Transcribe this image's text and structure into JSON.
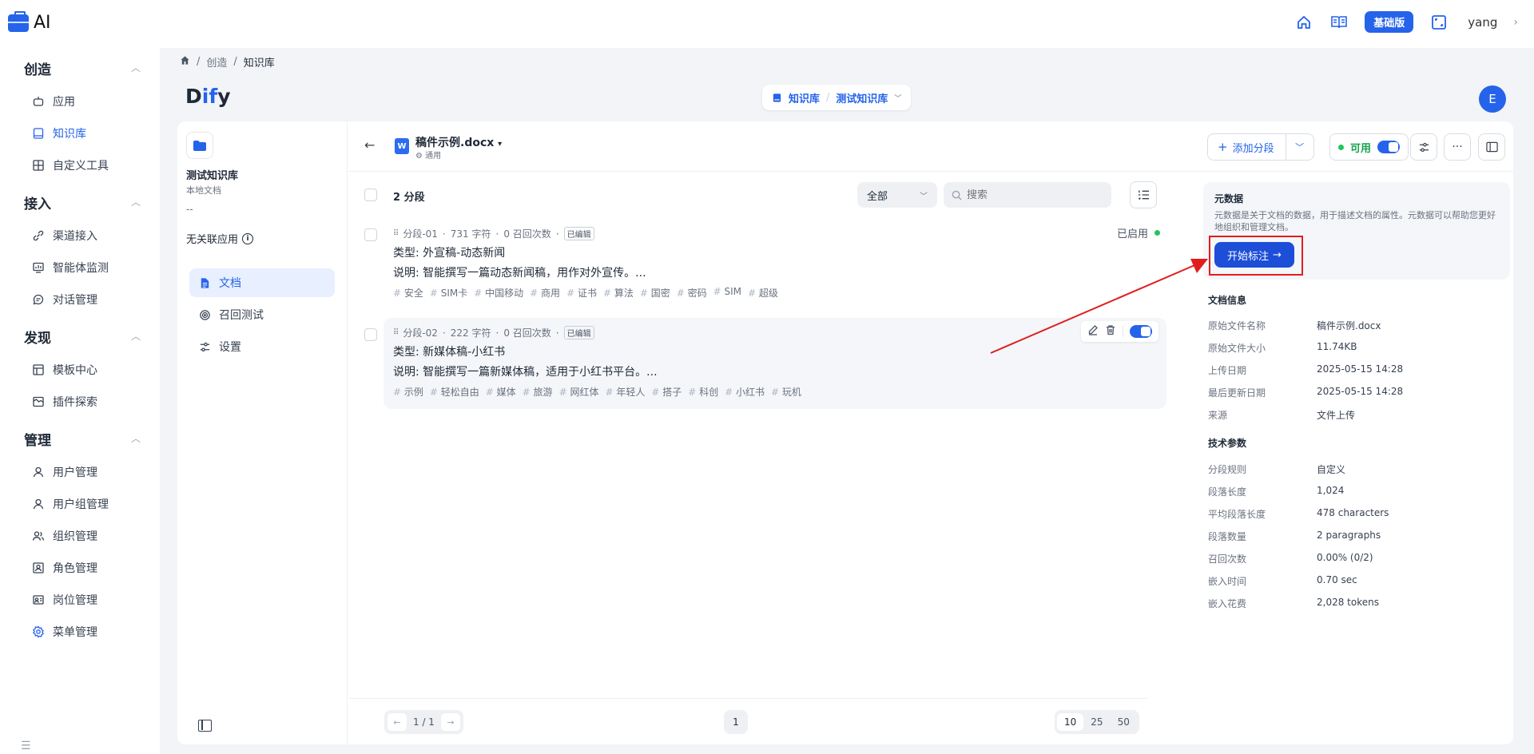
{
  "app": {
    "title": "AI"
  },
  "topbar": {
    "plan": "基础版",
    "username": "yang"
  },
  "sidebar": {
    "sections": [
      {
        "title": "创造",
        "items": [
          {
            "label": "应用",
            "icon": "robot-icon"
          },
          {
            "label": "知识库",
            "icon": "book-icon",
            "active": true
          },
          {
            "label": "自定义工具",
            "icon": "tool-icon"
          }
        ]
      },
      {
        "title": "接入",
        "items": [
          {
            "label": "渠道接入",
            "icon": "link-icon"
          },
          {
            "label": "智能体监测",
            "icon": "monitor-icon"
          },
          {
            "label": "对话管理",
            "icon": "chat-icon"
          }
        ]
      },
      {
        "title": "发现",
        "items": [
          {
            "label": "模板中心",
            "icon": "template-icon"
          },
          {
            "label": "插件探索",
            "icon": "plugin-icon"
          }
        ]
      },
      {
        "title": "管理",
        "items": [
          {
            "label": "用户管理",
            "icon": "user-icon"
          },
          {
            "label": "用户组管理",
            "icon": "user-group-icon"
          },
          {
            "label": "组织管理",
            "icon": "org-icon"
          },
          {
            "label": "角色管理",
            "icon": "role-icon"
          },
          {
            "label": "岗位管理",
            "icon": "post-icon"
          },
          {
            "label": "菜单管理",
            "icon": "menu-icon"
          }
        ]
      }
    ]
  },
  "breadcrumb": {
    "items": [
      "创造",
      "知识库"
    ]
  },
  "dify": {
    "brand_d": "D",
    "brand_i": "if",
    "brand_y": "y",
    "switch_root": "知识库",
    "switch_current": "测试知识库",
    "avatar": "E"
  },
  "kb": {
    "name": "测试知识库",
    "type": "本地文档",
    "dash": "--",
    "apps": "无关联应用",
    "nav": [
      {
        "label": "文档"
      },
      {
        "label": "召回测试"
      },
      {
        "label": "设置"
      }
    ]
  },
  "doc": {
    "title": "稿件示例.docx",
    "mode": "通用",
    "add_segment": "添加分段",
    "available": "可用",
    "segment_count": "2 分段",
    "filter": "全部",
    "search_placeholder": "搜索"
  },
  "segments": [
    {
      "id": "分段-01",
      "chars": "731 字符",
      "recalls": "0 召回次数",
      "edited": "已编辑",
      "line1": "类型: 外宣稿-动态新闻",
      "line2": "说明: 智能撰写一篇动态新闻稿，用作对外宣传。...",
      "tags": [
        "安全",
        "SIM卡",
        "中国移动",
        "商用",
        "证书",
        "算法",
        "国密",
        "密码",
        "SIM",
        "超级"
      ],
      "status": "已启用"
    },
    {
      "id": "分段-02",
      "chars": "222 字符",
      "recalls": "0 召回次数",
      "edited": "已编辑",
      "line1": "类型: 新媒体稿-小红书",
      "line2": "说明: 智能撰写一篇新媒体稿，适用于小红书平台。...",
      "tags": [
        "示例",
        "轻松自由",
        "媒体",
        "旅游",
        "网红体",
        "年轻人",
        "搭子",
        "科创",
        "小红书",
        "玩机"
      ]
    }
  ],
  "pagination": {
    "pager": "1 / 1",
    "current_page": "1",
    "sizes": [
      "10",
      "25",
      "50"
    ],
    "selected_size": "10"
  },
  "metadata": {
    "title": "元数据",
    "desc": "元数据是关于文档的数据，用于描述文档的属性。元数据可以帮助您更好地组织和管理文档。",
    "button": "开始标注"
  },
  "doc_info": {
    "title": "文档信息",
    "rows": [
      {
        "k": "原始文件名称",
        "v": "稿件示例.docx"
      },
      {
        "k": "原始文件大小",
        "v": "11.74KB"
      },
      {
        "k": "上传日期",
        "v": "2025-05-15 14:28"
      },
      {
        "k": "最后更新日期",
        "v": "2025-05-15 14:28"
      },
      {
        "k": "来源",
        "v": "文件上传"
      }
    ]
  },
  "tech_params": {
    "title": "技术参数",
    "rows": [
      {
        "k": "分段规则",
        "v": "自定义"
      },
      {
        "k": "段落长度",
        "v": "1,024"
      },
      {
        "k": "平均段落长度",
        "v": "478 characters"
      },
      {
        "k": "段落数量",
        "v": "2 paragraphs"
      },
      {
        "k": "召回次数",
        "v": "0.00% (0/2)"
      },
      {
        "k": "嵌入时间",
        "v": "0.70 sec"
      },
      {
        "k": "嵌入花费",
        "v": "2,028 tokens"
      }
    ]
  },
  "colors": {
    "accent": "#2563eb",
    "highlight_red": "#e11d1d",
    "enabled_green": "#22c55e"
  }
}
